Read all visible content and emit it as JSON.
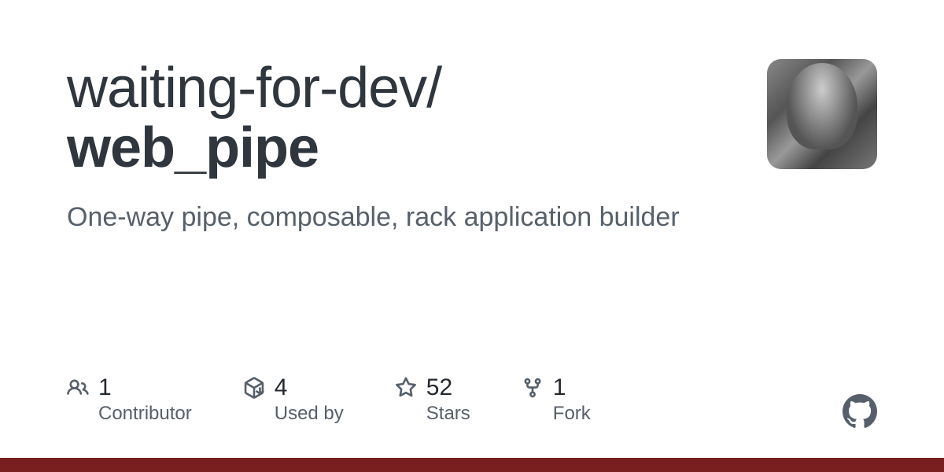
{
  "repo": {
    "owner": "waiting-for-dev/",
    "name": "web_pipe",
    "description": "One-way pipe, composable, rack application builder"
  },
  "stats": {
    "contributors": {
      "count": "1",
      "label": "Contributor"
    },
    "usedby": {
      "count": "4",
      "label": "Used by"
    },
    "stars": {
      "count": "52",
      "label": "Stars"
    },
    "forks": {
      "count": "1",
      "label": "Fork"
    }
  }
}
